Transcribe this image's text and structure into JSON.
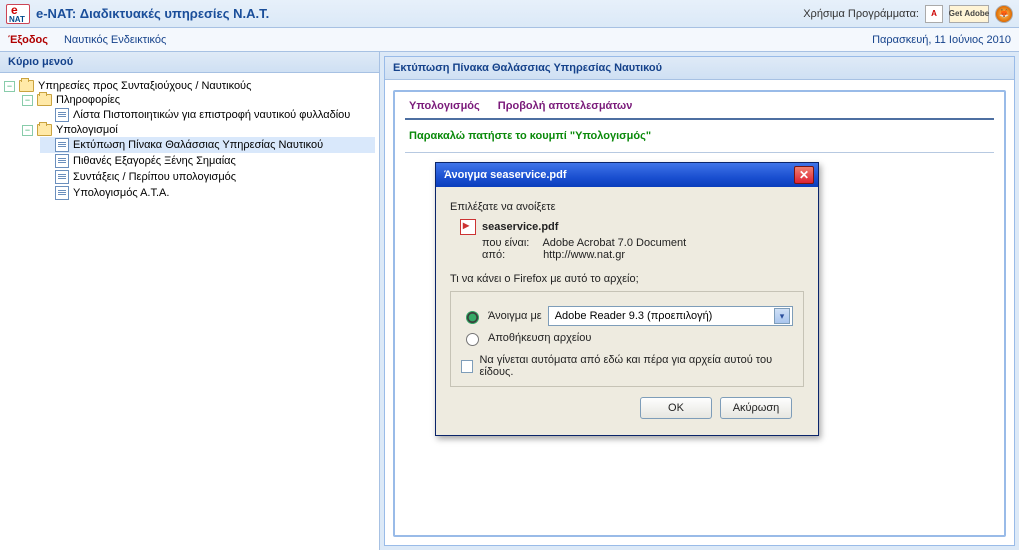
{
  "header": {
    "title": "e-NAT: Διαδικτυακές υπηρεσίες Ν.Α.Τ.",
    "useful_label": "Χρήσιμα Προγράμματα:"
  },
  "secondbar": {
    "exit": "Έξοδος",
    "nav": "Ναυτικός Ενδεικτικός",
    "date": "Παρασκευή, 11 Ιούνιος 2010"
  },
  "sidebar": {
    "title": "Κύριο μενού",
    "tree": {
      "root": "Υπηρεσίες προς Συνταξιούχους / Ναυτικούς",
      "info": "Πληροφορίες",
      "info_children": {
        "cert": "Λίστα Πιστοποιητικών για επιστροφή ναυτικού φυλλαδίου"
      },
      "calcs": "Υπολογισμοί",
      "calcs_children": {
        "seaservice": "Εκτύπωση Πίνακα Θαλάσσιας Υπηρεσίας Ναυτικού",
        "foreign": "Πιθανές Εξαγορές Ξένης Σημαίας",
        "pension": "Συντάξεις / Περίπου υπολογισμός",
        "ata": "Υπολογισμός Α.Τ.Α."
      }
    }
  },
  "panel": {
    "title": "Εκτύπωση Πίνακα Θαλάσσιας Υπηρεσίας Ναυτικού",
    "tab_calc": "Υπολογισμός",
    "tab_results": "Προβολή αποτελεσμάτων",
    "message": "Παρακαλώ πατήστε το κουμπί \"Υπολογισμός\""
  },
  "dialog": {
    "title": "Άνοιγμα seaservice.pdf",
    "you_chose": "Επιλέξατε να ανοίξετε",
    "filename": "seaservice.pdf",
    "which_is_label": "που είναι:",
    "which_is_value": "Adobe Acrobat 7.0 Document",
    "from_label": "από:",
    "from_value": "http://www.nat.gr",
    "question": "Τι να κάνει ο Firefox  με αυτό το αρχείο;",
    "open_with": "Άνοιγμα με",
    "open_with_app": "Adobe Reader 9.3 (προεπιλογή)",
    "save_file": "Αποθήκευση αρχείου",
    "remember": "Να γίνεται αυτόματα από εδώ και πέρα για αρχεία αυτού του είδους.",
    "ok": "OK",
    "cancel": "Ακύρωση"
  }
}
